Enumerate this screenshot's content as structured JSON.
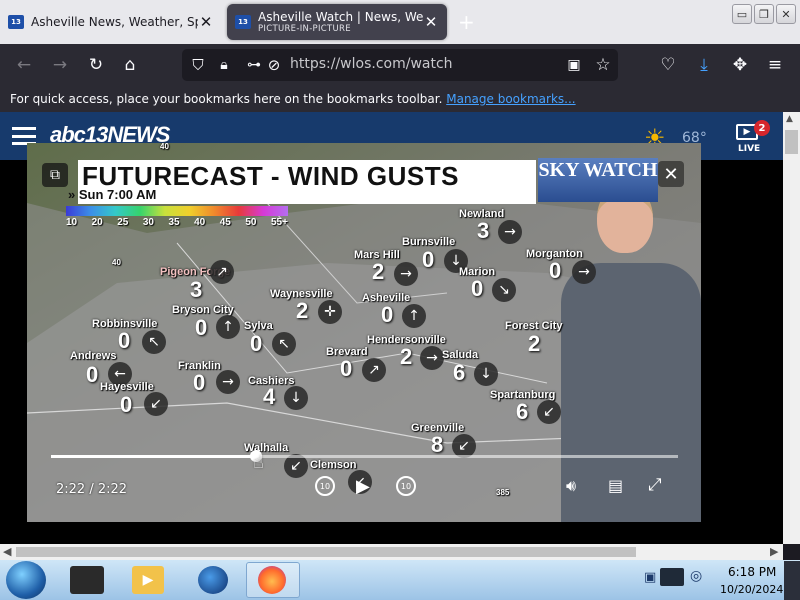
{
  "browser": {
    "tabs": [
      {
        "title": "Asheville News, Weather, Sports",
        "favicon": "13"
      },
      {
        "title": "Asheville Watch | News, Weather",
        "subtitle": "PICTURE-IN-PICTURE",
        "favicon": "13"
      }
    ],
    "url": "https://wlos.com/watch",
    "bookmarks_message": "For quick access, place your bookmarks here on the bookmarks toolbar.",
    "bookmarks_link": "Manage bookmarks..."
  },
  "site": {
    "logo": "abc13NEWS",
    "temperature": "68°",
    "live_label": "LIVE",
    "live_badge": "2"
  },
  "video": {
    "title": "FUTURECAST - WIND GUSTS",
    "subtitle": "» Sun 7:00 AM",
    "brand": "SKY WATCH",
    "legend": [
      "10",
      "20",
      "25",
      "30",
      "35",
      "40",
      "45",
      "50",
      "55+"
    ],
    "locations": [
      {
        "name": "Pigeon Forge",
        "value": "3"
      },
      {
        "name": "Bryson City",
        "value": "0"
      },
      {
        "name": "Robbinsville",
        "value": "0"
      },
      {
        "name": "Andrews",
        "value": "0"
      },
      {
        "name": "Hayesville",
        "value": "0"
      },
      {
        "name": "Franklin",
        "value": "0"
      },
      {
        "name": "Sylva",
        "value": "0"
      },
      {
        "name": "Waynesville",
        "value": "2"
      },
      {
        "name": "Cashiers",
        "value": "4"
      },
      {
        "name": "Brevard",
        "value": "0"
      },
      {
        "name": "Mars Hill",
        "value": "2"
      },
      {
        "name": "Burnsville",
        "value": "0"
      },
      {
        "name": "Asheville",
        "value": "0"
      },
      {
        "name": "Hendersonville",
        "value": "2"
      },
      {
        "name": "Saluda",
        "value": "6"
      },
      {
        "name": "Newland",
        "value": "3"
      },
      {
        "name": "Marion",
        "value": "0"
      },
      {
        "name": "Morganton",
        "value": "0"
      },
      {
        "name": "Forest City",
        "value": "2"
      },
      {
        "name": "Spartanburg",
        "value": "6"
      },
      {
        "name": "Greenville",
        "value": "8"
      },
      {
        "name": "Walhalla",
        "value": ""
      },
      {
        "name": "Clemson",
        "value": ""
      }
    ],
    "highway_labels": [
      "40",
      "40",
      "385"
    ],
    "time_display": "2:22 / 2:22",
    "progress": 0.33,
    "rewind_label": "10",
    "forward_label": "10"
  },
  "taskbar": {
    "time": "6:18 PM",
    "date": "10/20/2024"
  }
}
